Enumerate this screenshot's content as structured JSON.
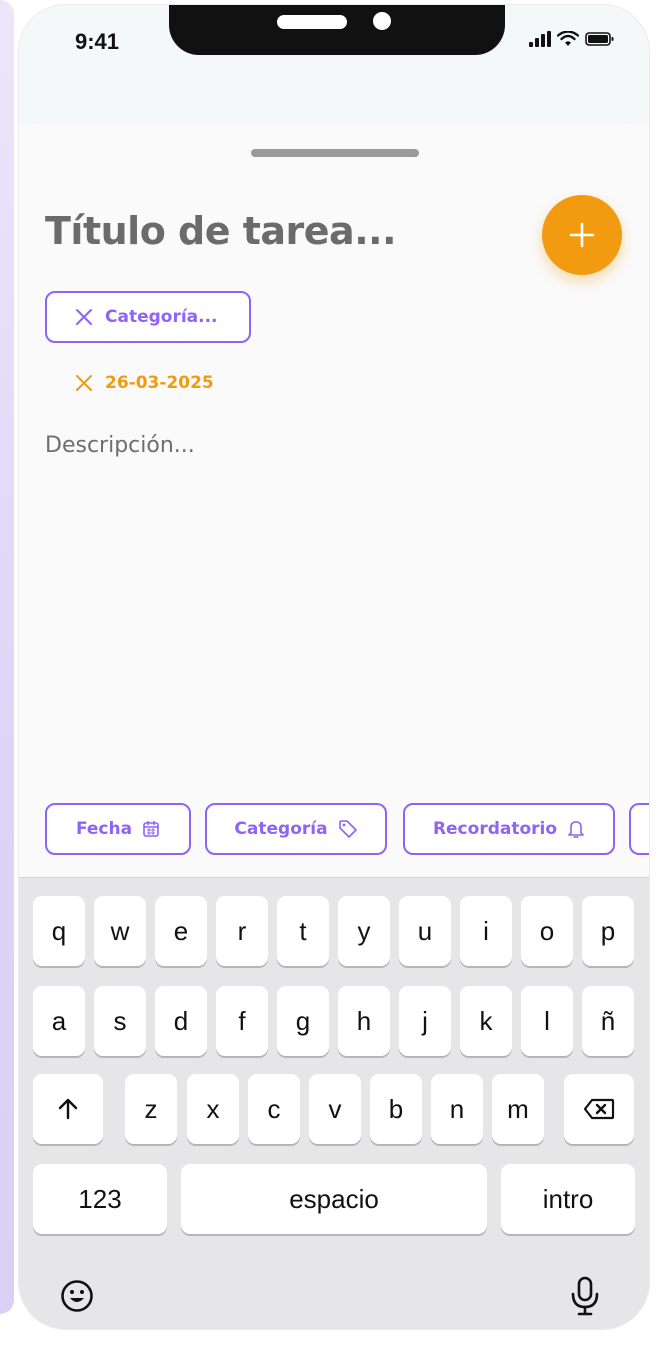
{
  "status_bar": {
    "time": "9:41"
  },
  "task": {
    "title": "Título de tarea...",
    "category": "Categoría...",
    "date": "26-03-2025",
    "description_placeholder": "Descripción..."
  },
  "actions": {
    "date_label": "Fecha",
    "category_label": "Categoría",
    "reminder_label": "Recordatorio"
  },
  "keyboard": {
    "row1": [
      "q",
      "w",
      "e",
      "r",
      "t",
      "y",
      "u",
      "i",
      "o",
      "p"
    ],
    "row2": [
      "a",
      "s",
      "d",
      "f",
      "g",
      "h",
      "j",
      "k",
      "l",
      "ñ"
    ],
    "row3": [
      "z",
      "x",
      "c",
      "v",
      "b",
      "n",
      "m"
    ],
    "numbers_label": "123",
    "space_label": "espacio",
    "return_label": "intro"
  },
  "colors": {
    "accent": "#8f63f4",
    "orange": "#f29a10"
  },
  "icons": [
    "close-icon",
    "plus-icon",
    "calendar-icon",
    "tag-icon",
    "bell-icon",
    "shift-icon",
    "backspace-icon",
    "emoji-icon",
    "microphone-icon"
  ]
}
